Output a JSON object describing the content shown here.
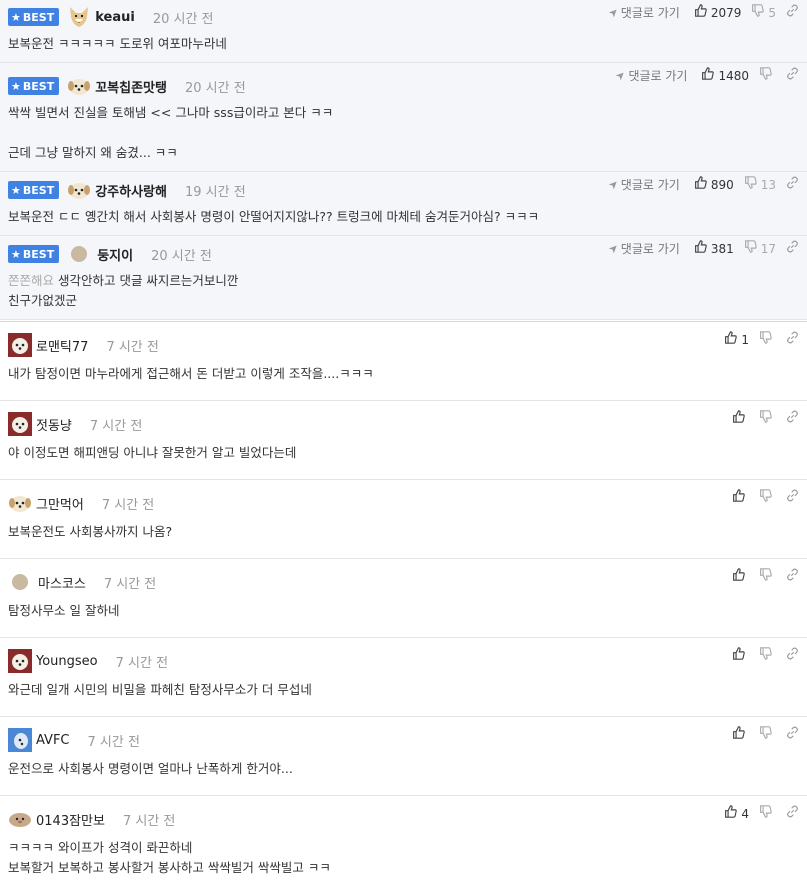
{
  "labels": {
    "best": "BEST",
    "reply": "댓글로 가기"
  },
  "colors": {
    "best_badge": "#3f82e4",
    "best_row_bg": "#f4f6fa"
  },
  "icons": {
    "star": "star-icon",
    "reply": "arrow-icon",
    "up": "thumbs-up-icon",
    "down": "thumbs-down-icon",
    "link": "link-icon"
  },
  "best_comments": [
    {
      "nick": "keaui",
      "time": "20 시간 전",
      "up": "2079",
      "down": "5",
      "lines": [
        "보복운전 ㅋㅋㅋㅋㅋ 도로위 여포마누라네"
      ]
    },
    {
      "nick": "꼬복칩존맛탱",
      "time": "20 시간 전",
      "up": "1480",
      "down": "",
      "lines": [
        "싹싹 빌면서 진실을 토해냄 << 그나마 sss급이라고 본다 ㅋㅋ",
        "",
        "근데 그냥 말하지 왜 숨겼... ㅋㅋ"
      ]
    },
    {
      "nick": "강주하사랑해",
      "time": "19 시간 전",
      "up": "890",
      "down": "13",
      "lines": [
        "보복운전 ㄷㄷ 옝간치 해서 사회봉사 명령이 안떨어지지않나?? 트렁크에 마체테 숨겨둔거아심? ㅋㅋㅋ"
      ]
    },
    {
      "nick": "둥지이",
      "time": "20 시간 전",
      "up": "381",
      "down": "17",
      "muted_prefix": "쫀쫀해요",
      "lines": [
        " 생각안하고 댓글 싸지르는거보니깐",
        "친구가없겠군"
      ]
    }
  ],
  "comments": [
    {
      "nick": "로맨틱77",
      "time": "7 시간 전",
      "up": "1",
      "down": "",
      "lines": [
        "내가 탐정이면 마누라에게 접근해서 돈 더받고 이렇게 조작을....ㅋㅋㅋ"
      ]
    },
    {
      "nick": "젓동냥",
      "time": "7 시간 전",
      "up": "",
      "down": "",
      "lines": [
        "야 이정도면 해피앤딩 아니냐 잘못한거 알고 빌었다는데"
      ]
    },
    {
      "nick": "그만먹어",
      "time": "7 시간 전",
      "up": "",
      "down": "",
      "lines": [
        "보복운전도 사회봉사까지 나옴?"
      ]
    },
    {
      "nick": "마스코스",
      "time": "7 시간 전",
      "up": "",
      "down": "",
      "lines": [
        "탐정사무소 일 잘하네"
      ]
    },
    {
      "nick": "Youngseo",
      "time": "7 시간 전",
      "up": "",
      "down": "",
      "lines": [
        "와근데 일개 시민의 비밀을 파헤친 탐정사무소가 더 무섭네"
      ]
    },
    {
      "nick": "AVFC",
      "time": "7 시간 전",
      "up": "",
      "down": "",
      "lines": [
        "운전으로 사회봉사 명령이면 얼마나 난폭하게 한거야..."
      ]
    },
    {
      "nick": "0143잠만보",
      "time": "7 시간 전",
      "up": "4",
      "down": "",
      "lines": [
        "ㅋㅋㅋㅋ 와이프가 성격이 롸끈하네",
        "보복할거 보복하고 봉사할거 봉사하고 싹싹빌거 싹싹빌고 ㅋㅋ"
      ]
    }
  ]
}
